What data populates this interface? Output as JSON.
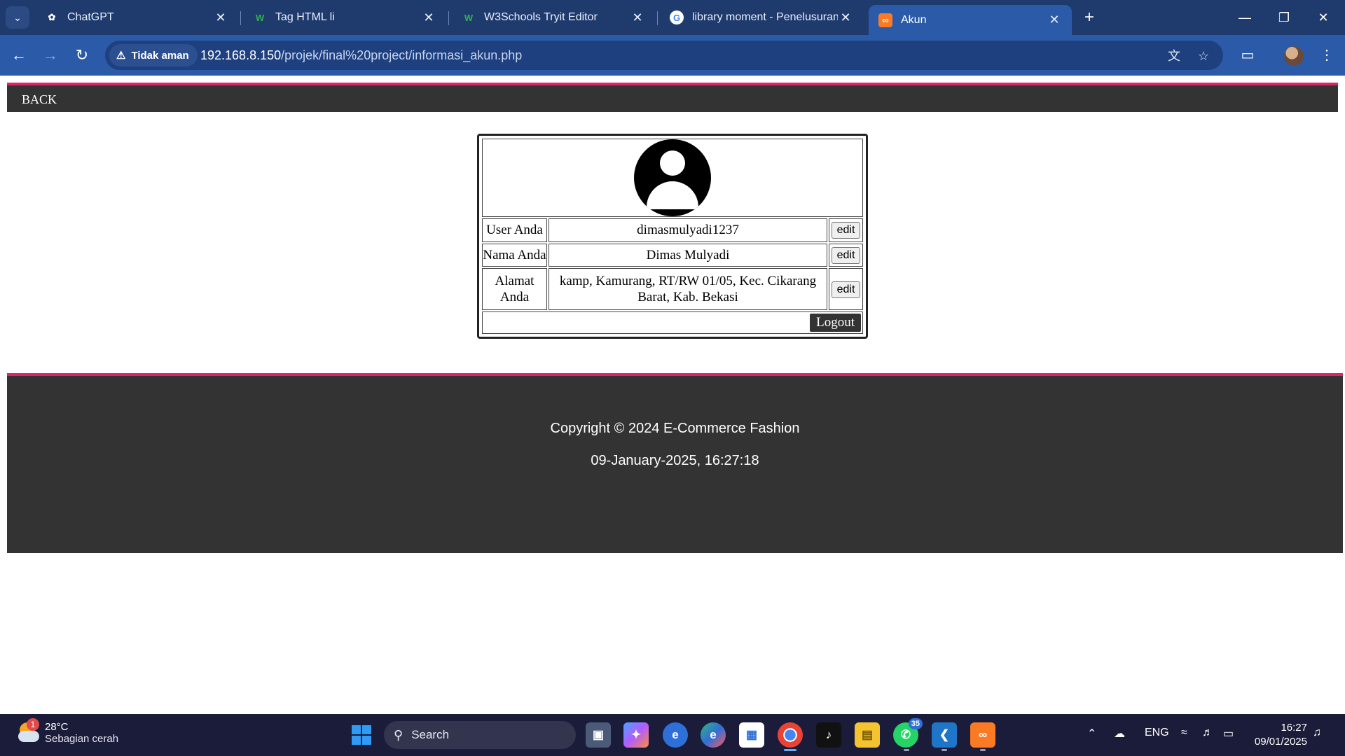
{
  "browser": {
    "tabs": [
      {
        "title": "ChatGPT",
        "favicon": "chatgpt-icon"
      },
      {
        "title": "Tag HTML li",
        "favicon": "w3schools-icon"
      },
      {
        "title": "W3Schools Tryit Editor",
        "favicon": "w3schools-icon"
      },
      {
        "title": "library moment - Penelusuran G",
        "favicon": "google-icon"
      },
      {
        "title": "Akun",
        "favicon": "xampp-icon"
      }
    ],
    "security_label": "Tidak aman",
    "url_host": "192.168.8.150",
    "url_path": "/projek/final%20project/informasi_akun.php"
  },
  "page": {
    "back_label": "BACK",
    "account": {
      "rows": [
        {
          "label": "User Anda",
          "value": "dimasmulyadi1237",
          "edit": "edit"
        },
        {
          "label": "Nama Anda",
          "value": "Dimas Mulyadi",
          "edit": "edit"
        },
        {
          "label": "Alamat Anda",
          "value": "kamp, Kamurang, RT/RW 01/05, Kec. Cikarang Barat, Kab. Bekasi",
          "edit": "edit"
        }
      ],
      "logout_label": "Logout"
    },
    "footer": {
      "copyright": "Copyright © 2024 E-Commerce Fashion",
      "datetime": "09-January-2025, 16:27:18"
    },
    "colors": {
      "accent": "#e0246a",
      "bar": "#333333"
    }
  },
  "taskbar": {
    "weather_temp": "28°C",
    "weather_desc": "Sebagian cerah",
    "weather_badge": "1",
    "search_label": "Search",
    "whatsapp_count": "35",
    "language": "ENG",
    "time": "16:27",
    "date": "09/01/2025"
  }
}
